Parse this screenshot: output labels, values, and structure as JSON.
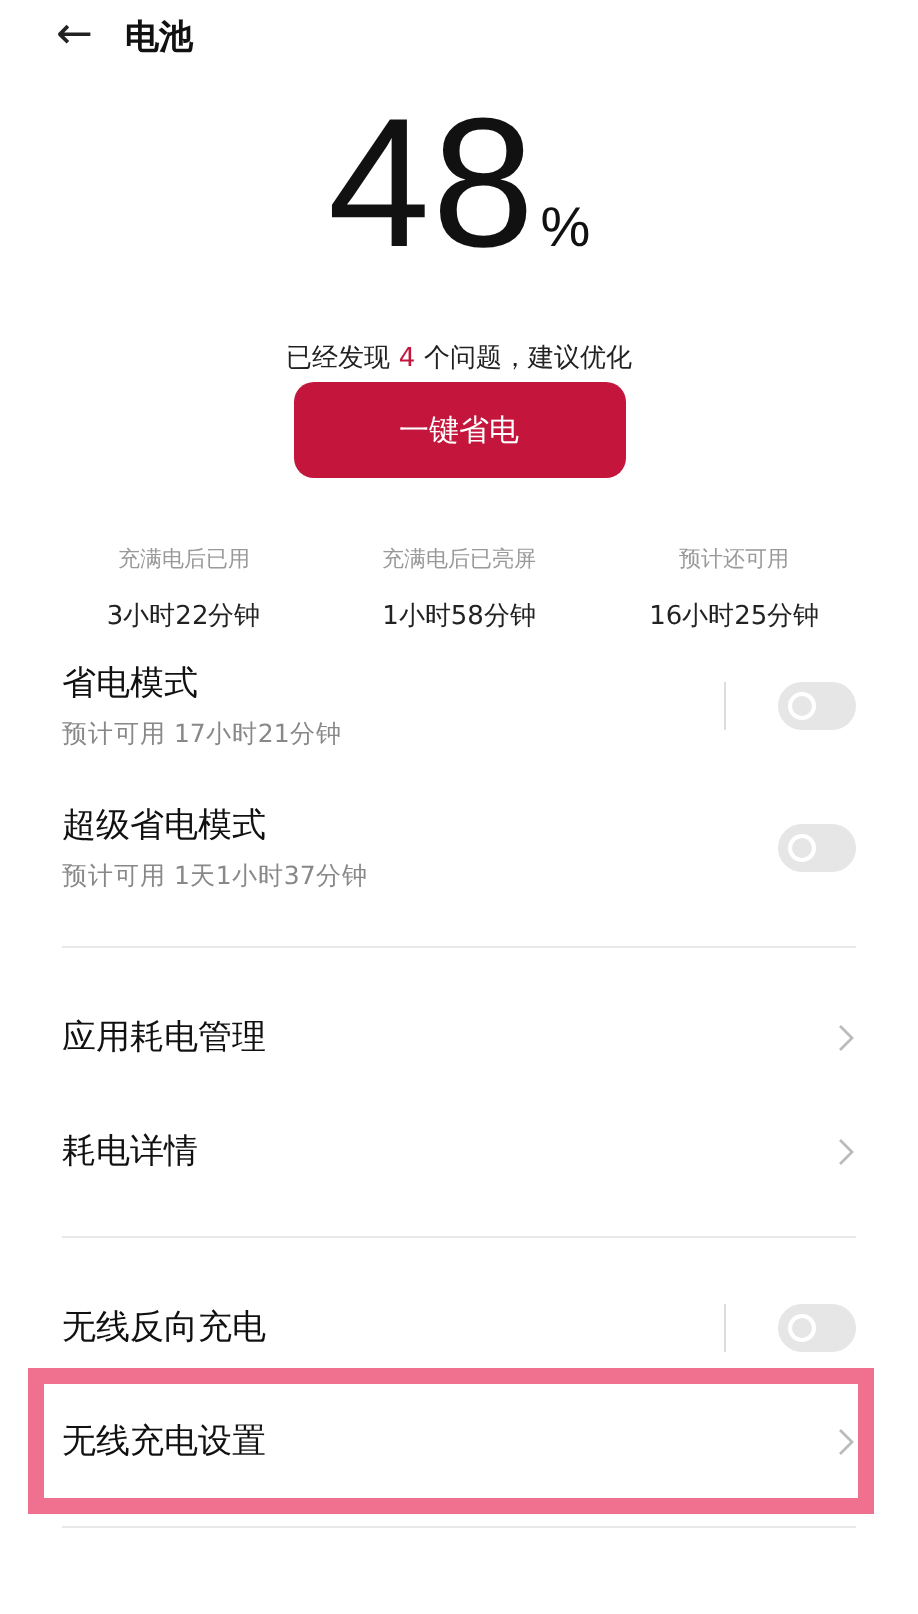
{
  "header": {
    "back": "←",
    "title": "电池"
  },
  "battery": {
    "value": "48",
    "unit": "%"
  },
  "notice": "已经发现 **4** 个问题，建议优化",
  "optimize_button": "一键省电",
  "stats": [
    {
      "label": "充满电后已用",
      "value": "3小时22分钟"
    },
    {
      "label": "充满电后已亮屏",
      "value": "1小时58分钟"
    },
    {
      "label": "预计还可用",
      "value": "16小时25分钟"
    }
  ],
  "sections": [
    {
      "items": [
        {
          "kind": "toggle",
          "title": "省电模式",
          "subtitle": "预计可用 17小时21分钟",
          "on": false,
          "separator": true
        },
        {
          "kind": "toggle",
          "title": "超级省电模式",
          "subtitle": "预计可用 1天1小时37分钟",
          "on": false,
          "separator": false
        }
      ]
    },
    {
      "items": [
        {
          "kind": "link",
          "title": "应用耗电管理",
          "highlighted": false
        },
        {
          "kind": "link",
          "title": "耗电详情",
          "highlighted": false
        }
      ]
    },
    {
      "items": [
        {
          "kind": "toggle",
          "title": "无线反向充电",
          "on": false,
          "separator": true
        },
        {
          "kind": "link",
          "title": "无线充电设置",
          "highlighted": true
        }
      ]
    }
  ]
}
